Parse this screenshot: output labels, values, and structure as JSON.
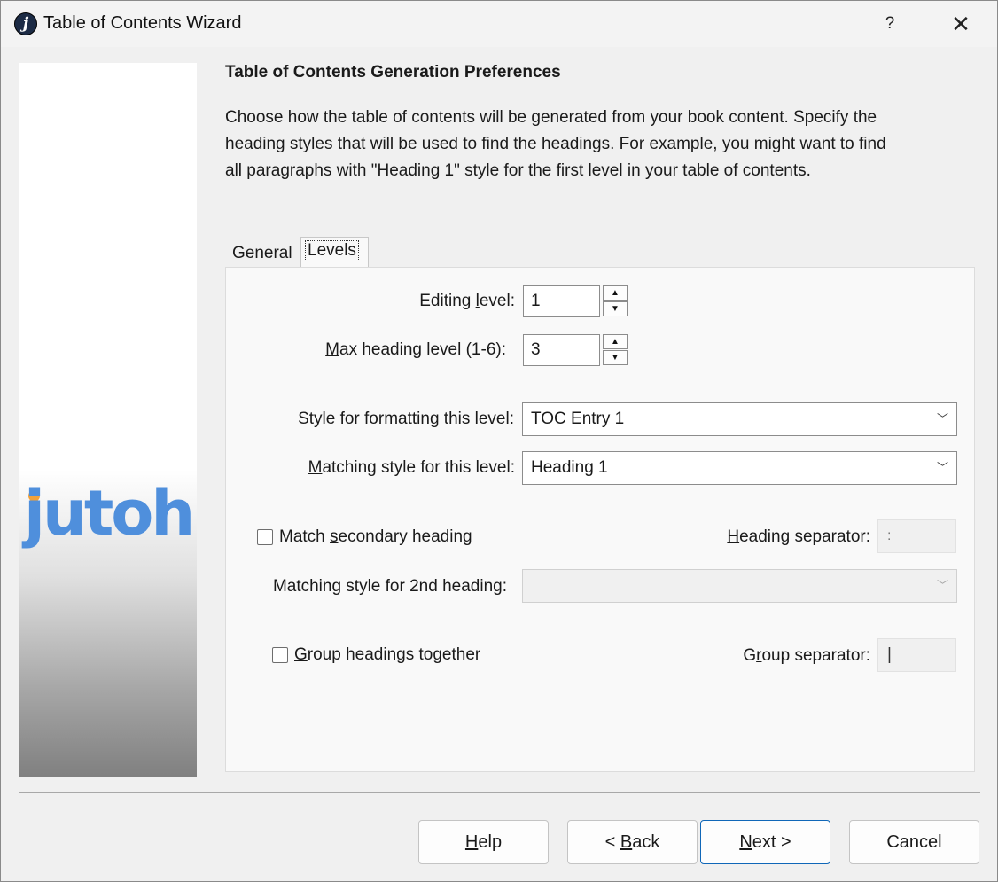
{
  "window": {
    "title": "Table of Contents Wizard",
    "help_label": "?",
    "close_label": "✕"
  },
  "sidebar": {
    "logo_text": "jutoh"
  },
  "page": {
    "heading": "Table of Contents Generation Preferences",
    "description": "Choose how the table of contents will be generated from your book content. Specify the heading styles that will be used to find the headings. For example, you might want to find all paragraphs with \"Heading 1\" style for the first level in your table of contents."
  },
  "tabs": [
    {
      "label": "General",
      "selected": false
    },
    {
      "label": "Levels",
      "selected": true
    }
  ],
  "levels": {
    "editing_level": {
      "label_pre": "Editing ",
      "label_mn": "l",
      "label_post": "evel:",
      "value": "1"
    },
    "max_heading_level": {
      "label_pre": "",
      "label_mn": "M",
      "label_post": "ax heading level (1-6):",
      "value": "3"
    },
    "style_formatting": {
      "label_pre": "Style for formatting ",
      "label_mn": "t",
      "label_post": "his level:",
      "value": "TOC Entry 1"
    },
    "matching_style": {
      "label_pre": "",
      "label_mn": "M",
      "label_post": "atching style for this level:",
      "value": "Heading 1"
    },
    "match_secondary": {
      "label_pre": "Match ",
      "label_mn": "s",
      "label_post": "econdary heading",
      "checked": false
    },
    "heading_separator": {
      "label_pre": "",
      "label_mn": "H",
      "label_post": "eading separator:",
      "value": ":"
    },
    "matching_style_2nd": {
      "label": "Matching style for 2nd heading:",
      "value": ""
    },
    "group_headings": {
      "label_pre": "",
      "label_mn": "G",
      "label_post": "roup headings together",
      "checked": false
    },
    "group_separator": {
      "label_pre": "G",
      "label_mn": "r",
      "label_post": "oup separator:",
      "value": "|"
    }
  },
  "buttons": {
    "help": {
      "pre": "",
      "mn": "H",
      "post": "elp"
    },
    "back": {
      "pre": "< ",
      "mn": "B",
      "post": "ack"
    },
    "next": {
      "pre": "",
      "mn": "N",
      "post": "ext >"
    },
    "cancel": {
      "label": "Cancel"
    }
  },
  "colors": {
    "accent": "#1067b8",
    "logo_blue": "#4f8fdc",
    "logo_dot": "#f2a23a"
  }
}
